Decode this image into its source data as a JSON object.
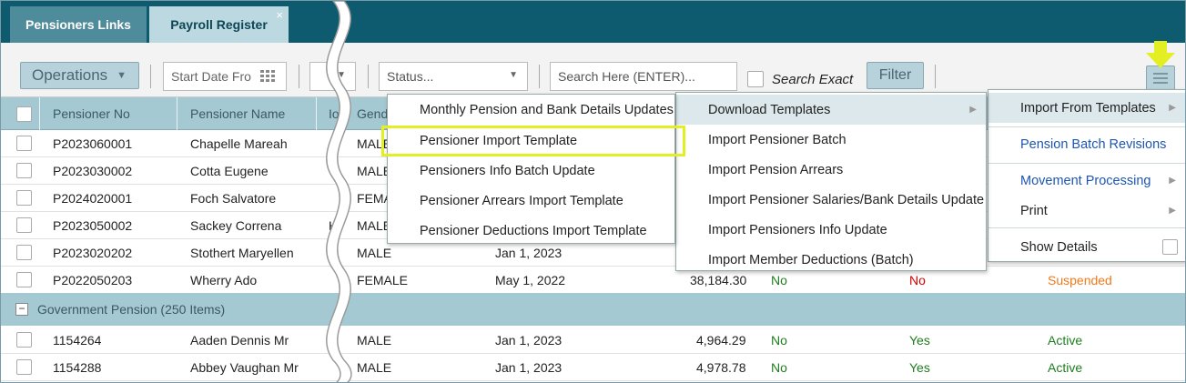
{
  "tabs": [
    {
      "label": "Pensioners Links"
    },
    {
      "label": "Payroll Register",
      "close": "×"
    }
  ],
  "toolbar": {
    "operations_label": "Operations",
    "start_date_placeholder": "Start Date Fro",
    "status_placeholder": "Status...",
    "search_placeholder": "Search Here (ENTER)...",
    "search_exact_label": "Search Exact",
    "filter_label": "Filter"
  },
  "grid": {
    "columns": [
      "Pensioner No",
      "Pensioner Name",
      "Io",
      "Gend"
    ],
    "rows": [
      {
        "no": "P2023060001",
        "name": "Chapelle Mareah",
        "id": "",
        "gender": "MALE"
      },
      {
        "no": "P2023030002",
        "name": "Cotta Eugene",
        "id": "",
        "gender": "MALE"
      },
      {
        "no": "P2024020001",
        "name": "Foch Salvatore",
        "id": "",
        "gender": "FEMA"
      },
      {
        "no": "P2023050002",
        "name": "Sackey Correna",
        "id": "H",
        "gender": "MALE"
      },
      {
        "no": "P2023020202",
        "name": "Stothert Maryellen",
        "id": "",
        "gender": "MALE",
        "date": "Jan 1, 2023"
      },
      {
        "no": "P2022050203",
        "name": "Wherry Ado",
        "id": "",
        "gender": "FEMALE",
        "date": "May 1, 2022",
        "amount": "38,184.30",
        "flag1": "No",
        "flag2": "No",
        "status": "Suspended"
      }
    ],
    "group": {
      "label": "Government Pension (250 Items)",
      "toggle": "−"
    },
    "group_rows": [
      {
        "no": "1154264",
        "name": "Aaden Dennis Mr",
        "gender": "MALE",
        "date": "Jan 1, 2023",
        "amount": "4,964.29",
        "flag1": "No",
        "flag2": "Yes",
        "status": "Active"
      },
      {
        "no": "1154288",
        "name": "Abbey Vaughan Mr",
        "gender": "MALE",
        "date": "Jan 1, 2023",
        "amount": "4,978.78",
        "flag1": "No",
        "flag2": "Yes",
        "status": "Active"
      }
    ]
  },
  "menu_main": {
    "items": [
      {
        "label": "Import From Templates"
      },
      {
        "label": "Pension Batch Revisions"
      },
      {
        "label": "Movement Processing"
      },
      {
        "label": "Print"
      },
      {
        "label": "Show Details"
      }
    ]
  },
  "menu_import": {
    "items": [
      {
        "label": "Download Templates"
      },
      {
        "label": "Import Pensioner Batch"
      },
      {
        "label": "Import Pension Arrears"
      },
      {
        "label": "Import Pensioner Salaries/Bank Details Update"
      },
      {
        "label": "Import Pensioners Info Update"
      },
      {
        "label": "Import Member Deductions (Batch)"
      }
    ]
  },
  "menu_download": {
    "items": [
      {
        "label": "Monthly Pension and Bank Details Updates"
      },
      {
        "label": "Pensioner Import Template"
      },
      {
        "label": "Pensioners Info Batch Update"
      },
      {
        "label": "Pensioner Arrears Import Template"
      },
      {
        "label": "Pensioner Deductions Import Template"
      }
    ]
  },
  "colors": {
    "tabbar": "#0e5a6e",
    "header": "#a5c9d3",
    "highlight": "#e3ef22",
    "link_blue": "#1d56b2",
    "green": "#1e7d1e",
    "red": "#d40000",
    "orange": "#f07a1b"
  }
}
